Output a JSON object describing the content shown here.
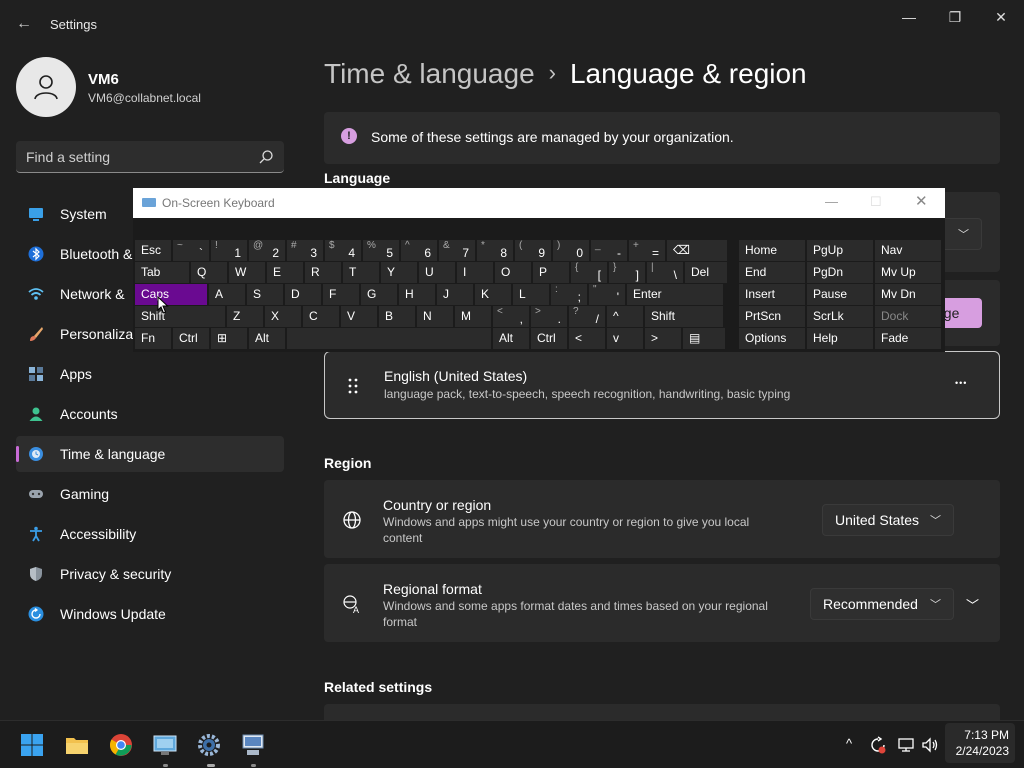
{
  "window": {
    "app_title": "Settings",
    "back_glyph": "←",
    "minimize_glyph": "—",
    "maximize_glyph": "❐",
    "close_glyph": "✕"
  },
  "profile": {
    "name": "VM6",
    "email": "VM6@collabnet.local"
  },
  "search": {
    "placeholder": "Find a setting"
  },
  "sidebar": {
    "items": [
      {
        "label": "System",
        "icon": "monitor-icon"
      },
      {
        "label": "Bluetooth &",
        "icon": "bluetooth-icon"
      },
      {
        "label": "Network &",
        "icon": "wifi-icon"
      },
      {
        "label": "Personalizat",
        "icon": "brush-icon"
      },
      {
        "label": "Apps",
        "icon": "apps-icon"
      },
      {
        "label": "Accounts",
        "icon": "person-icon"
      },
      {
        "label": "Time & language",
        "icon": "clock-globe-icon",
        "active": true
      },
      {
        "label": "Gaming",
        "icon": "gamepad-icon"
      },
      {
        "label": "Accessibility",
        "icon": "accessibility-icon"
      },
      {
        "label": "Privacy & security",
        "icon": "shield-icon"
      },
      {
        "label": "Windows Update",
        "icon": "update-icon"
      }
    ]
  },
  "breadcrumb": {
    "parent": "Time & language",
    "separator": "›",
    "current": "Language & region"
  },
  "notice": {
    "icon_glyph": "!",
    "text": "Some of these settings are managed by your organization."
  },
  "language": {
    "section_title": "Language",
    "hidden_button_label": "age",
    "item": {
      "name": "English (United States)",
      "details": "language pack, text-to-speech, speech recognition, handwriting, basic typing",
      "more_glyph": "•••"
    }
  },
  "region": {
    "section_title": "Region",
    "country": {
      "title": "Country or region",
      "description": "Windows and apps might use your country or region to give you local content",
      "value": "United States"
    },
    "format": {
      "title": "Regional format",
      "description": "Windows and some apps format dates and times based on your regional format",
      "value": "Recommended"
    }
  },
  "related": {
    "section_title": "Related settings"
  },
  "osk": {
    "title": "On-Screen Keyboard",
    "rows": [
      [
        {
          "main": "Esc",
          "w": 36
        },
        {
          "sub": "~",
          "sub2": "`",
          "w": 36
        },
        {
          "sub": "!",
          "sub2": "1",
          "w": 36
        },
        {
          "sub": "@",
          "sub2": "2",
          "w": 36
        },
        {
          "sub": "#",
          "sub2": "3",
          "w": 36
        },
        {
          "sub": "$",
          "sub2": "4",
          "w": 36
        },
        {
          "sub": "%",
          "sub2": "5",
          "w": 36
        },
        {
          "sub": "^",
          "sub2": "6",
          "w": 36
        },
        {
          "sub": "&",
          "sub2": "7",
          "w": 36
        },
        {
          "sub": "*",
          "sub2": "8",
          "w": 36
        },
        {
          "sub": "(",
          "sub2": "9",
          "w": 36
        },
        {
          "sub": ")",
          "sub2": "0",
          "w": 36
        },
        {
          "sub": "_",
          "sub2": "-",
          "w": 36
        },
        {
          "sub": "+",
          "sub2": "=",
          "w": 36
        },
        {
          "main": "⌫",
          "w": 60
        }
      ],
      [
        {
          "main": "Tab",
          "w": 54
        },
        {
          "main": "Q",
          "w": 36
        },
        {
          "main": "W",
          "w": 36
        },
        {
          "main": "E",
          "w": 36
        },
        {
          "main": "R",
          "w": 36
        },
        {
          "main": "T",
          "w": 36
        },
        {
          "main": "Y",
          "w": 36
        },
        {
          "main": "U",
          "w": 36
        },
        {
          "main": "I",
          "w": 36
        },
        {
          "main": "O",
          "w": 36
        },
        {
          "main": "P",
          "w": 36
        },
        {
          "sub": "{",
          "sub2": "[",
          "w": 36
        },
        {
          "sub": "}",
          "sub2": "]",
          "w": 36
        },
        {
          "sub": "|",
          "sub2": "\\",
          "w": 36
        },
        {
          "main": "Del",
          "w": 42
        }
      ],
      [
        {
          "main": "Caps",
          "w": 72,
          "caps": true
        },
        {
          "main": "A",
          "w": 36
        },
        {
          "main": "S",
          "w": 36
        },
        {
          "main": "D",
          "w": 36
        },
        {
          "main": "F",
          "w": 36
        },
        {
          "main": "G",
          "w": 36
        },
        {
          "main": "H",
          "w": 36
        },
        {
          "main": "J",
          "w": 36
        },
        {
          "main": "K",
          "w": 36
        },
        {
          "main": "L",
          "w": 36
        },
        {
          "sub": ":",
          "sub2": ";",
          "w": 36
        },
        {
          "sub": "\"",
          "sub2": "'",
          "w": 36
        },
        {
          "main": "Enter",
          "w": 96
        }
      ],
      [
        {
          "main": "Shift",
          "w": 90
        },
        {
          "main": "Z",
          "w": 36
        },
        {
          "main": "X",
          "w": 36
        },
        {
          "main": "C",
          "w": 36
        },
        {
          "main": "V",
          "w": 36
        },
        {
          "main": "B",
          "w": 36
        },
        {
          "main": "N",
          "w": 36
        },
        {
          "main": "M",
          "w": 36
        },
        {
          "sub": "<",
          "sub2": ",",
          "w": 36
        },
        {
          "sub": ">",
          "sub2": ".",
          "w": 36
        },
        {
          "sub": "?",
          "sub2": "/",
          "w": 36
        },
        {
          "main": "^",
          "w": 36
        },
        {
          "main": "Shift",
          "w": 78
        }
      ],
      [
        {
          "main": "Fn",
          "w": 36
        },
        {
          "main": "Ctrl",
          "w": 36
        },
        {
          "main": "⊞",
          "w": 36
        },
        {
          "main": "Alt",
          "w": 36
        },
        {
          "main": "",
          "w": 204
        },
        {
          "main": "Alt",
          "w": 36
        },
        {
          "main": "Ctrl",
          "w": 36
        },
        {
          "main": "<",
          "w": 36
        },
        {
          "main": "v",
          "w": 36
        },
        {
          "main": ">",
          "w": 36
        },
        {
          "main": "▤",
          "w": 42
        }
      ]
    ],
    "nav_keys": [
      [
        "Home",
        "PgUp",
        "Nav"
      ],
      [
        "End",
        "PgDn",
        "Mv Up"
      ],
      [
        "Insert",
        "Pause",
        "Mv Dn"
      ],
      [
        "PrtScn",
        "ScrLk",
        "Dock"
      ],
      [
        "Options",
        "Help",
        "Fade"
      ]
    ]
  },
  "taskbar": {
    "apps": [
      "start-icon",
      "file-explorer-icon",
      "chrome-icon",
      "remote-desktop-icon",
      "settings-icon",
      "network-app-icon"
    ],
    "tray": {
      "chevron_glyph": "^",
      "time": "7:13 PM",
      "date": "2/24/2023"
    }
  }
}
